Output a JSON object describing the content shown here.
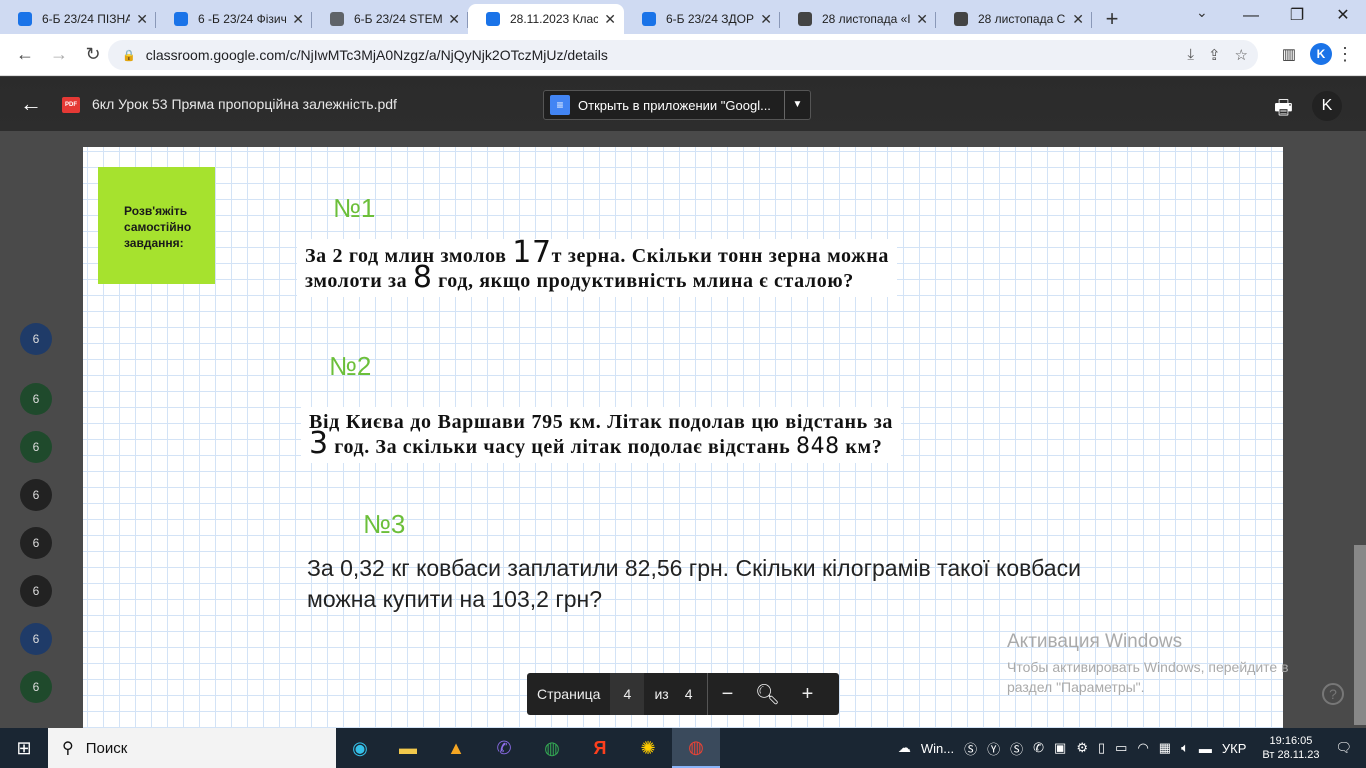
{
  "browser": {
    "tabs": [
      {
        "title": "6-Б 23/24 ПІЗНА",
        "color": "#1a73e8",
        "active": false
      },
      {
        "title": "6 -Б 23/24 Фізич",
        "color": "#1a73e8",
        "active": false
      },
      {
        "title": "6-Б 23/24 STEM",
        "color": "#5f6368",
        "active": false
      },
      {
        "title": "28.11.2023 Клас",
        "color": "#1a73e8",
        "active": true
      },
      {
        "title": "6-Б 23/24 ЗДОР",
        "color": "#1a73e8",
        "active": false
      },
      {
        "title": "28 листопада «I",
        "color": "#444444",
        "active": false
      },
      {
        "title": "28 листопада С",
        "color": "#444444",
        "active": false
      }
    ],
    "url": "classroom.google.com/c/NjIwMTc3MjA0Nzgz/a/NjQyNjk2OTczMjUz/details",
    "profile_initial": "K"
  },
  "viewer": {
    "file_title": "6кл Урок 53 Пряма пропорційна залежність.pdf",
    "pdf_badge": "PDF",
    "open_with_label": "Открыть в приложении \"Googl...",
    "page_label": "Страница",
    "page_current": "4",
    "of_label": "из",
    "page_total": "4"
  },
  "pdf": {
    "green_box_text": "Розв'яжіть самостійно завдання:",
    "task1": {
      "number": "№1",
      "text_a": "За 2 год млин змолов",
      "hand_a": "17",
      "text_b": "т зерна. Скільки тонн зерна можна змолоти за",
      "hand_b": "8",
      "text_c": "год, якщо продуктивність млина є сталою?"
    },
    "task2": {
      "number": "№2",
      "text_a": "Від Києва до Варшави 795 км. Літак подолав цю відстань за",
      "hand_a": "3",
      "text_b": "год. За скільки часу цей літак подолає відстань",
      "hand_b": "848",
      "text_c": "км?"
    },
    "task3": {
      "number": "№3",
      "text": "За 0,32 кг ковбаси заплатили 82,56 грн. Скільки кілограмів такої ковбаси можна купити на 103,2 грн?"
    }
  },
  "watermark": {
    "title": "Активация Windows",
    "subtitle": "Чтобы активировать Windows, перейдите в раздел \"Параметры\"."
  },
  "taskbar": {
    "search_label": "Поиск",
    "win_label": "Win...",
    "language": "УКР",
    "time": "19:16:05",
    "date": "Вт 28.11.23"
  }
}
